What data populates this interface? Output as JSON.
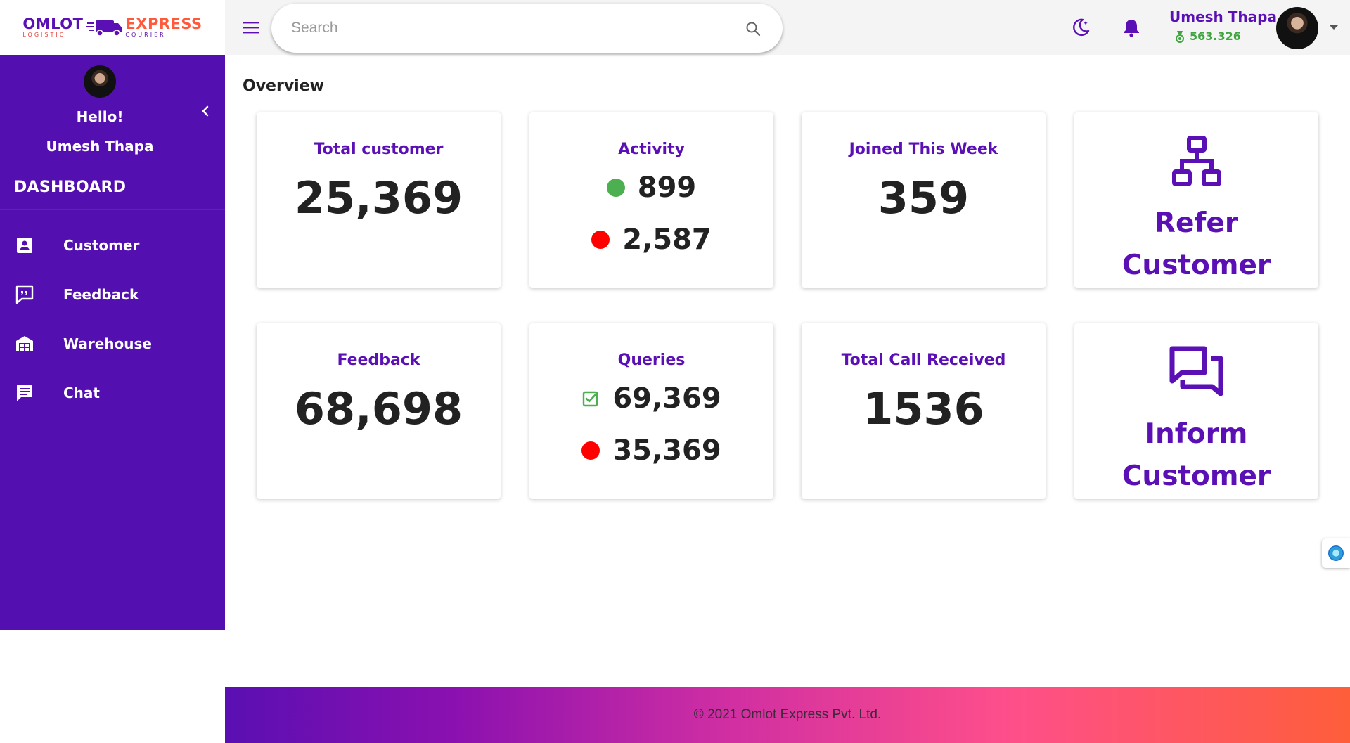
{
  "brand": {
    "left_main": "OMLOT",
    "left_sub": "LOGISTIC",
    "right_main": "EXPRESS",
    "right_sub": "COURIER",
    "colors": {
      "purple": "#5a10b5",
      "orange": "#ff5a3c"
    }
  },
  "topbar": {
    "menu_icon": "hamburger-menu-icon",
    "search_placeholder": "Search",
    "search_icon": "search-icon",
    "theme_icon": "moon-icon",
    "notification_icon": "bell-icon",
    "user_name": "Umesh Thapa",
    "balance": "563.326",
    "balance_icon": "medal-icon"
  },
  "sidebar": {
    "greeting": "Hello!",
    "user_name": "Umesh Thapa",
    "section_title": "DASHBOARD",
    "collapse_icon": "chevron-left-icon",
    "items": [
      {
        "label": "Customer",
        "icon": "contact-card-icon"
      },
      {
        "label": "Feedback",
        "icon": "feedback-icon"
      },
      {
        "label": "Warehouse",
        "icon": "warehouse-icon"
      },
      {
        "label": "Chat",
        "icon": "chat-icon"
      }
    ],
    "color": "#530fb0"
  },
  "main": {
    "title": "Overview",
    "cards": {
      "total_customer": {
        "title": "Total customer",
        "value": "25,369"
      },
      "activity": {
        "title": "Activity",
        "active": "899",
        "inactive": "2,587"
      },
      "joined": {
        "title": "Joined This Week",
        "value": "359"
      },
      "refer": {
        "line1": "Refer",
        "line2": "Customer",
        "icon": "network-icon"
      },
      "feedback": {
        "title": "Feedback",
        "value": "68,698"
      },
      "queries": {
        "title": "Queries",
        "resolved": "69,369",
        "pending": "35,369"
      },
      "calls": {
        "title": "Total Call Received",
        "value": "1536"
      },
      "inform": {
        "line1": "Inform",
        "line2": "Customer",
        "icon": "forum-icon"
      }
    },
    "status_colors": {
      "green": "#4caf50",
      "red": "#ff0000"
    }
  },
  "footer": {
    "text": "© 2021 Omlot Express Pvt. Ltd."
  }
}
